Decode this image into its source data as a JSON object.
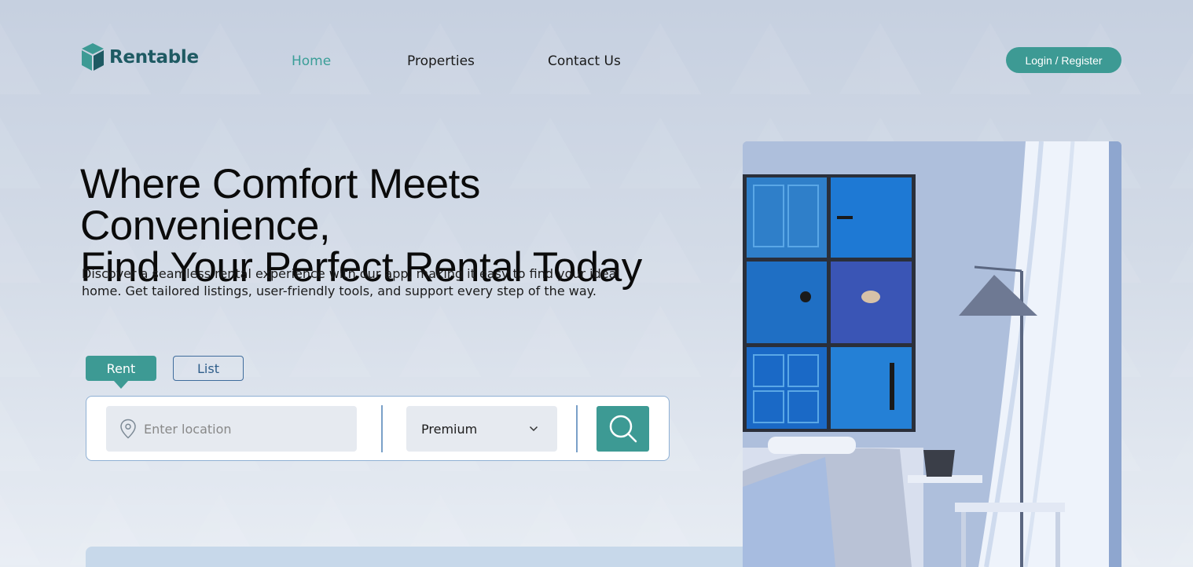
{
  "header": {
    "logo_text": "Rentable",
    "nav": [
      "Home",
      "Properties",
      "Contact Us"
    ],
    "login_label": "Login / Register"
  },
  "hero": {
    "title_line1": "Where Comfort Meets Convenience,",
    "title_line2": "Find Your Perfect Rental Today",
    "description_line1": "Discover a seamless rental experience with our app, making it easy to find your ideal",
    "description_line2": "home. Get tailored listings, user-friendly tools, and support every step of the way."
  },
  "search": {
    "tabs": [
      "Rent",
      "List"
    ],
    "active_tab": "Rent",
    "location_placeholder": "Enter location",
    "location_value": "",
    "category_value": "Premium"
  },
  "colors": {
    "accent": "#3d9a94",
    "brand": "#1e5a63",
    "nav_active": "#3b9e98"
  },
  "icons": [
    "logo-cube-icon",
    "location-pin-icon",
    "chevron-down-icon",
    "search-icon"
  ]
}
